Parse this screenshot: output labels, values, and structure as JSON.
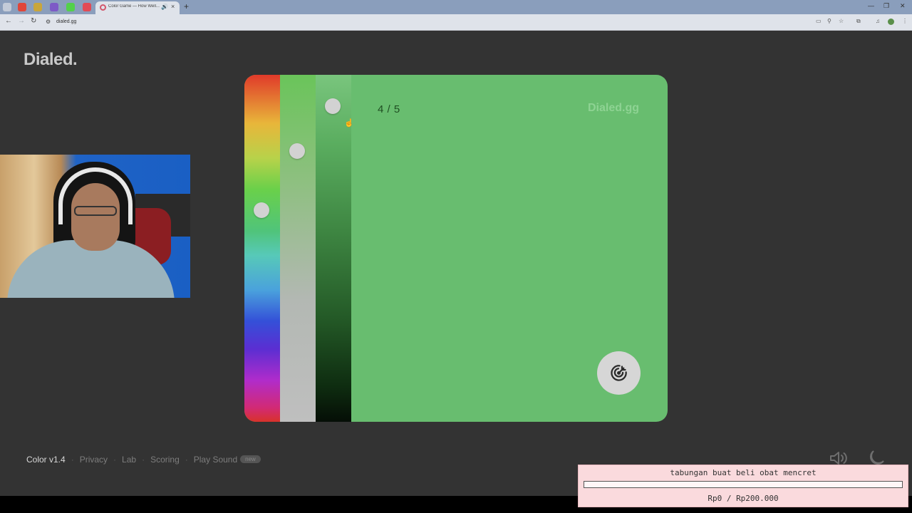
{
  "browser": {
    "tab_title": "Color Game — How Well...",
    "new_tab": "+",
    "url": "dialed.gg",
    "win_controls": [
      "—",
      "❐",
      "✕"
    ]
  },
  "page": {
    "logo": "Dialed.",
    "counter": "4 / 5",
    "watermark": "Dialed.gg",
    "target_color": "#68bd6f"
  },
  "picker": {
    "hue_level": 0.39,
    "saturation_level": 0.22,
    "lightness_level": 0.09
  },
  "footer": {
    "version": "Color v1.4",
    "links": [
      "Privacy",
      "Lab",
      "Scoring",
      "Play Sound"
    ],
    "badge": "new",
    "separator": "·"
  },
  "overlay": {
    "title": "tabungan buat beli obat mencret",
    "amount": "Rp0 / Rp200.000",
    "progress": 0
  },
  "colors": {
    "background": "#333333",
    "card_green": "#68bd6f",
    "knob": "#d2d2d2",
    "overlay_bg": "#fadadd"
  },
  "icons": {
    "submit": "target-arrow-icon",
    "sound": "speaker-icon",
    "theme": "moon-icon"
  }
}
